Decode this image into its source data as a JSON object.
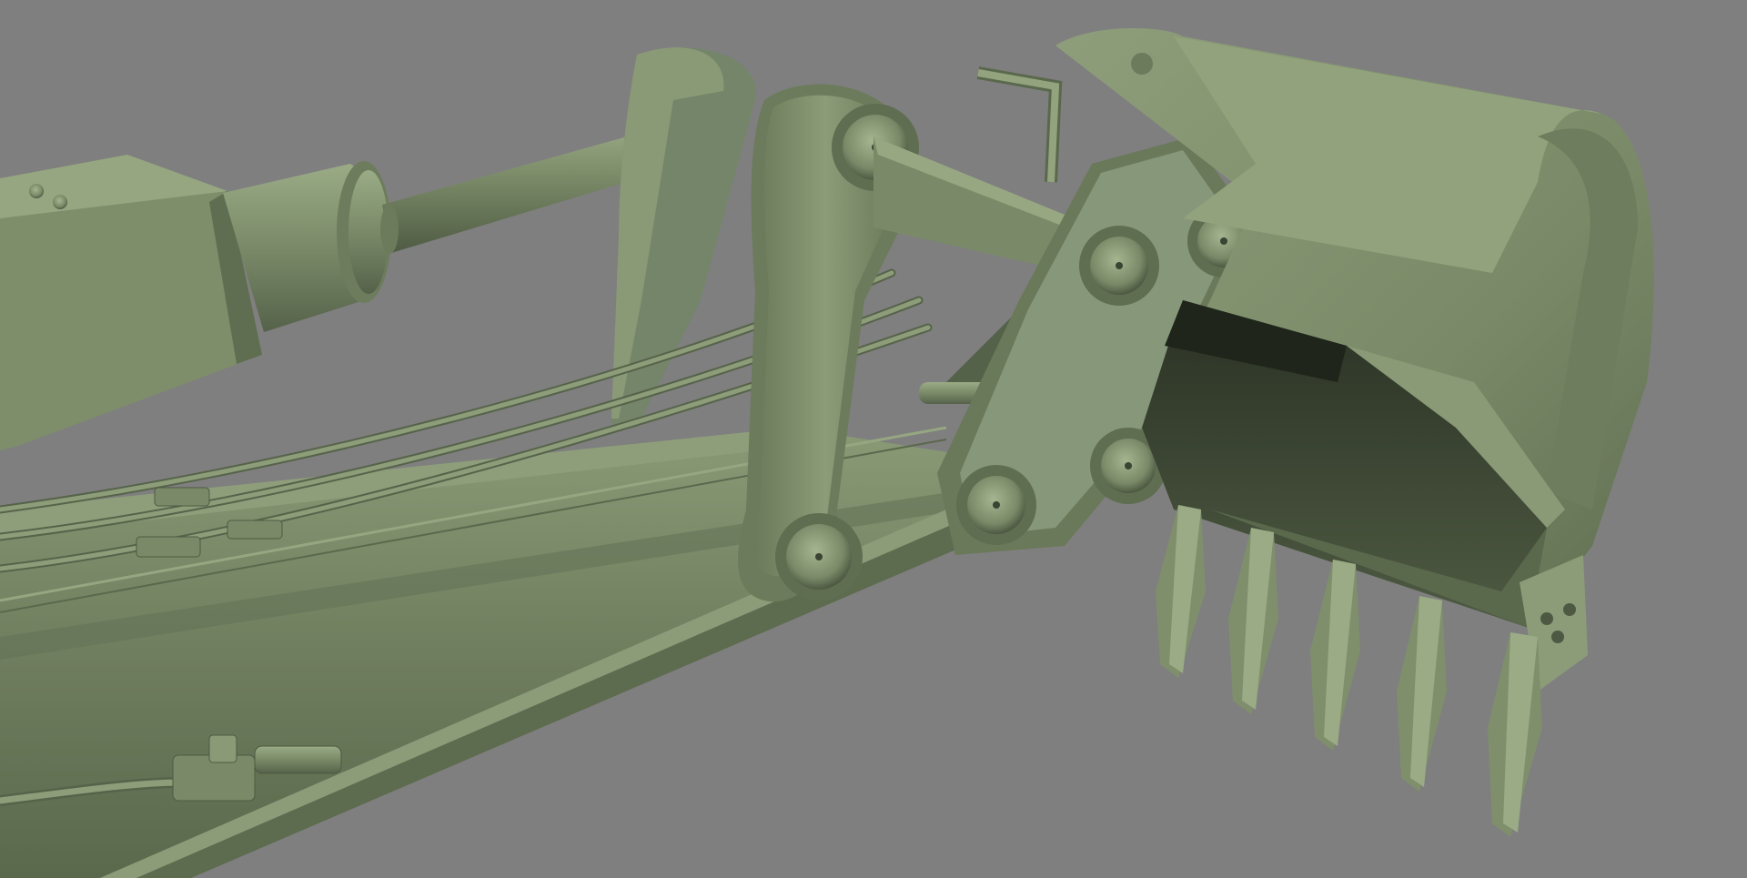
{
  "scene": {
    "subject": "excavator-arm-bucket-3d-render",
    "background_color": "#7f7f7f",
    "model_color": "#7a8a68",
    "model_highlight": "#93a37e",
    "model_shadow": "#4b5640",
    "model_dark": "#262c20",
    "bucket_tooth_count": 5
  }
}
